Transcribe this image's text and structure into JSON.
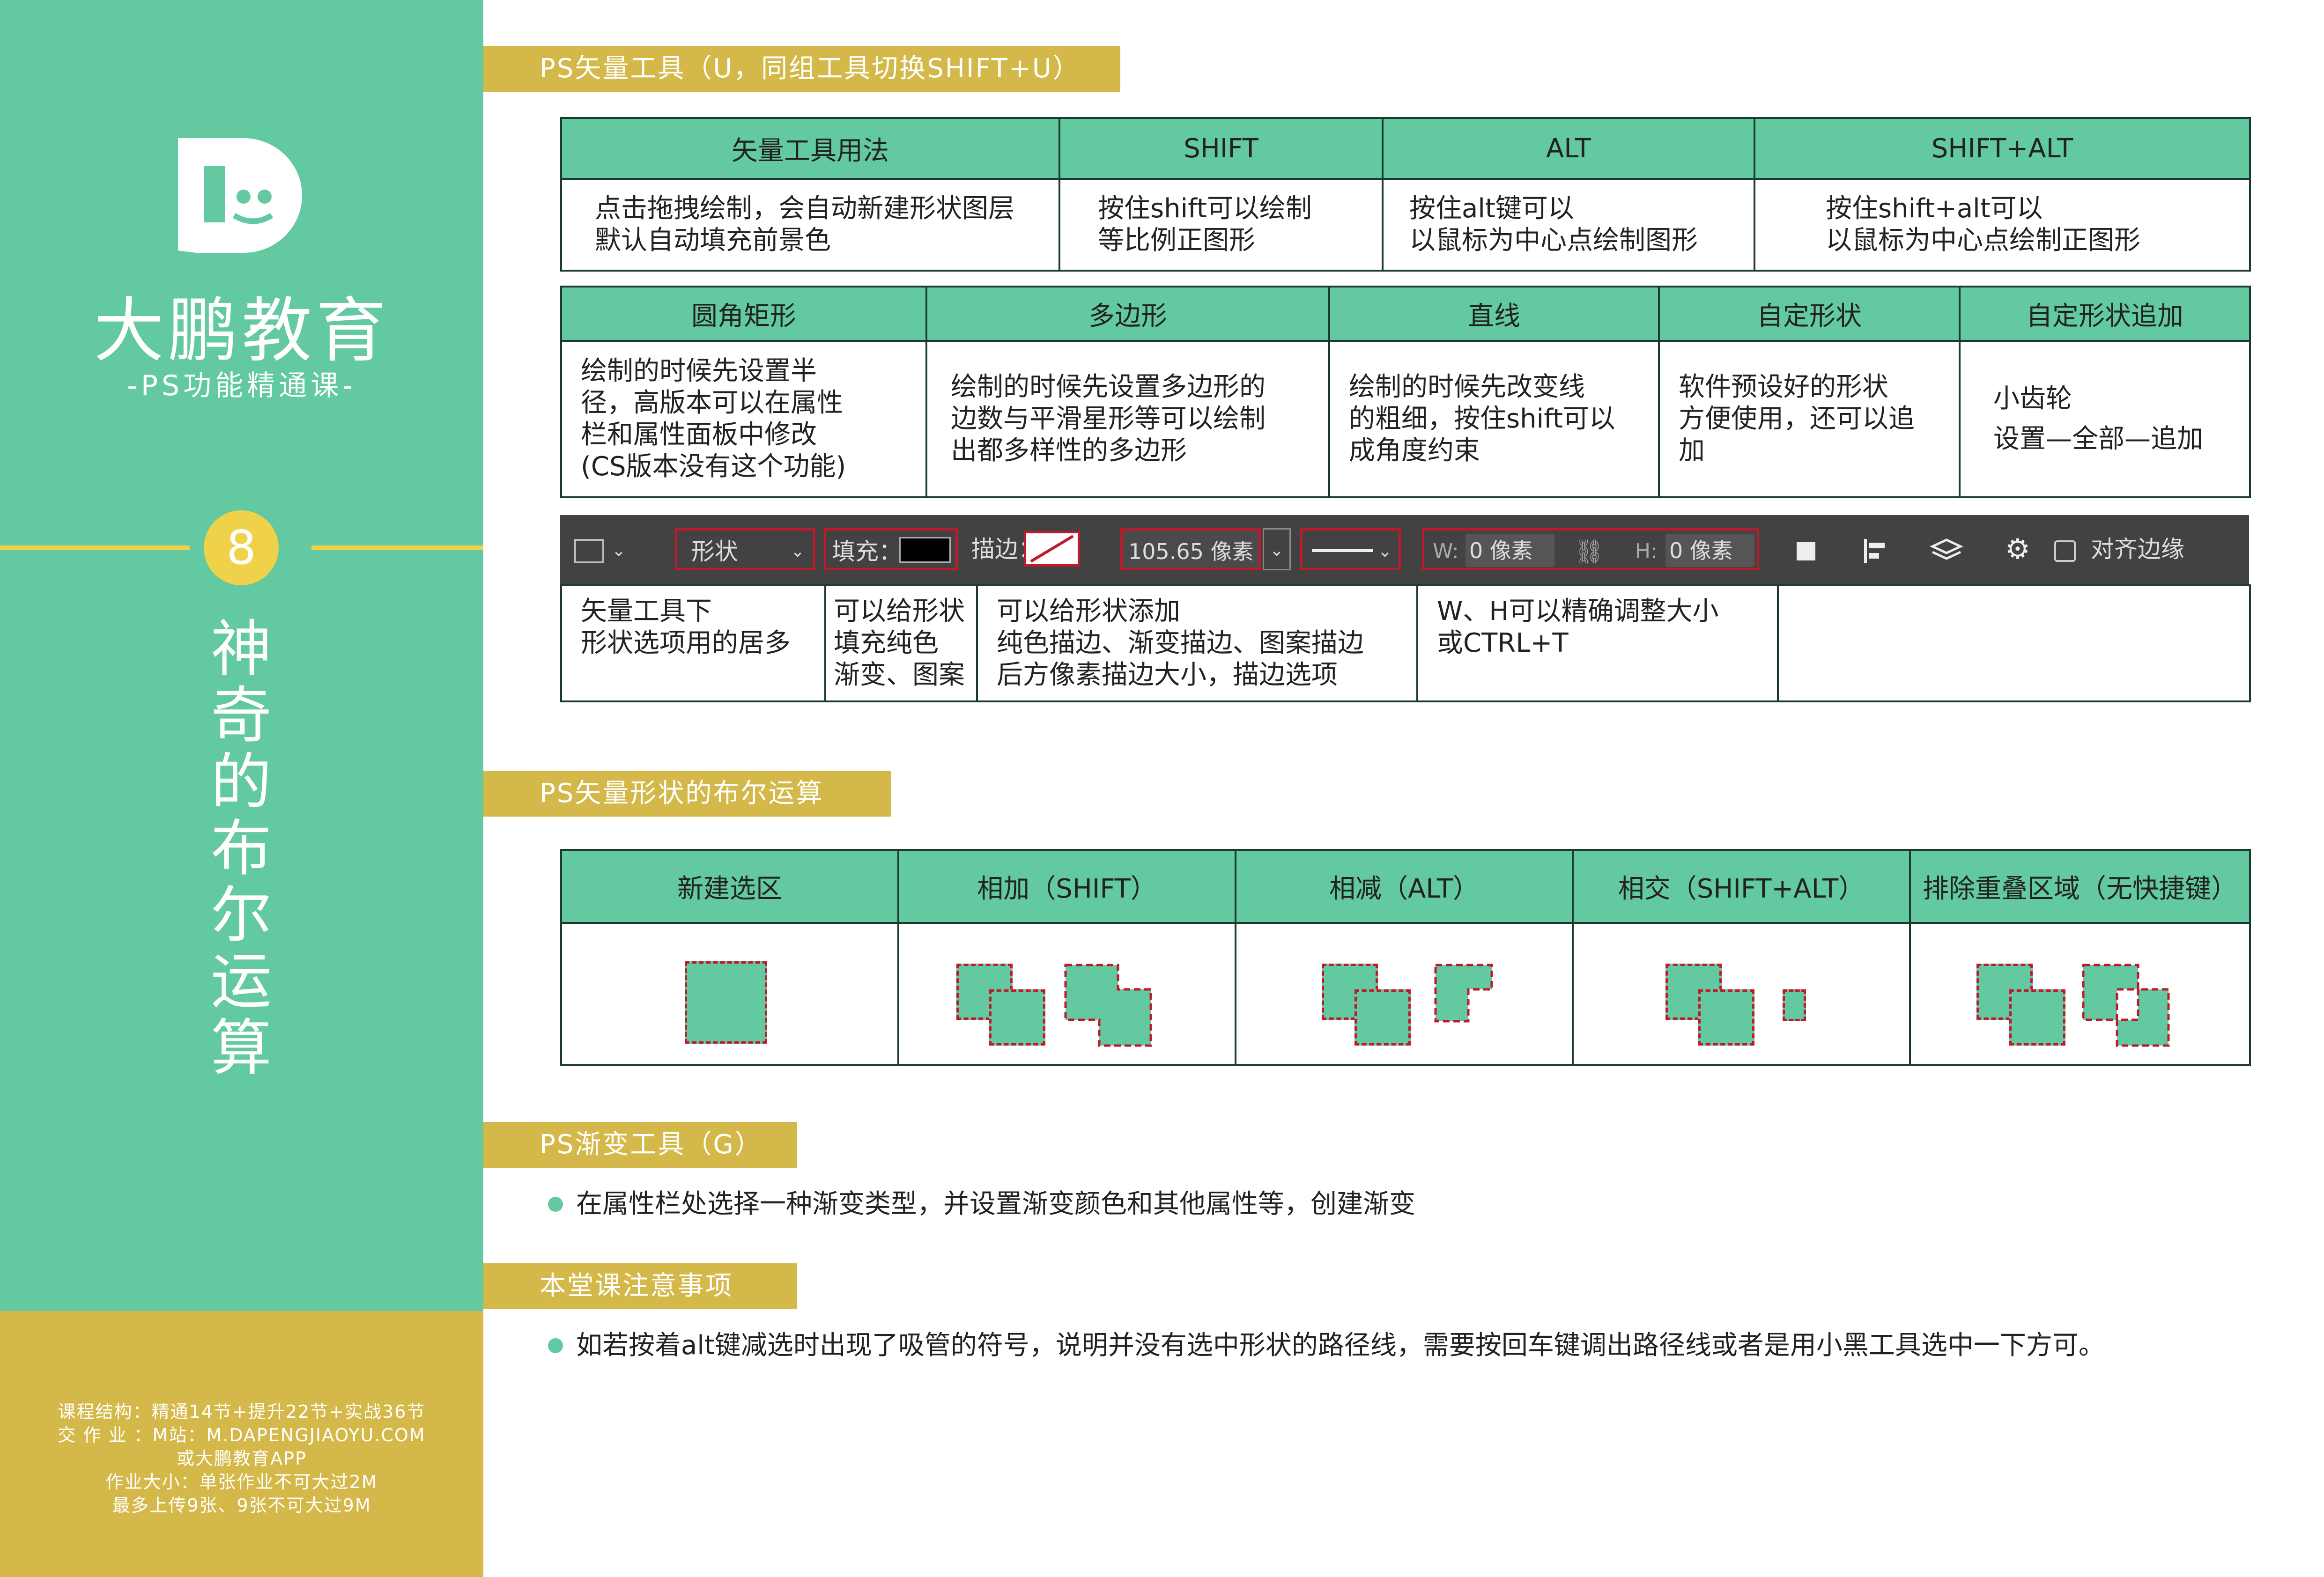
{
  "sidebar": {
    "brand": "大鹏教育",
    "subtitle": "-PS功能精通课-",
    "lesson_number": "8",
    "lesson_title": [
      "神",
      "奇",
      "的",
      "布",
      "尔",
      "运",
      "算"
    ],
    "footer_lines": [
      "课程结构：精通14节+提升22节+实战36节",
      "交 作 业 ：M站：M.DAPENGJIAOYU.COM",
      "或大鹏教育APP",
      "作业大小：单张作业不可大过2M",
      "最多上传9张、9张不可大过9M"
    ]
  },
  "colors": {
    "teal": "#62c9a0",
    "gold": "#d4b94a",
    "yellow": "#f0d24a",
    "red_dash": "#c0192c",
    "toolbar": "#424242"
  },
  "sections": {
    "vector": "PS矢量工具（U，同组工具切换SHIFT+U）",
    "boolean": "PS矢量形状的布尔运算",
    "gradient": "PS渐变工具（G）",
    "notes": "本堂课注意事项"
  },
  "table1": {
    "headers": [
      "矢量工具用法",
      "SHIFT",
      "ALT",
      "SHIFT+ALT"
    ],
    "cells": [
      "点击拖拽绘制，会自动新建形状图层\n默认自动填充前景色",
      "按住shift可以绘制\n等比例正图形",
      "按住alt键可以\n以鼠标为中心点绘制图形",
      "按住shift+alt可以\n以鼠标为中心点绘制正图形"
    ]
  },
  "table2": {
    "headers": [
      "圆角矩形",
      "多边形",
      "直线",
      "自定形状",
      "自定形状追加"
    ],
    "cells": [
      "绘制的时候先设置半\n径，高版本可以在属性\n栏和属性面板中修改\n(CS版本没有这个功能)",
      "绘制的时候先设置多边形的\n边数与平滑星形等可以绘制\n出都多样性的多边形",
      "绘制的时候先改变线\n的粗细，按住shift可以\n成角度约束",
      "软件预设好的形状\n方便使用，还可以追加",
      "小齿轮\n设置—全部—追加"
    ]
  },
  "toolbar": {
    "mode": "形状",
    "fill_label": "填充：",
    "stroke_label": "描边：",
    "stroke_width": "105.65 像素",
    "w_label": "W:",
    "w_value": "0 像素",
    "h_label": "H:",
    "h_value": "0 像素",
    "align_edges": "对齐边缘"
  },
  "table3": {
    "cells": [
      "矢量工具下\n形状选项用的居多",
      "可以给形状\n填充纯色\n渐变、图案",
      "可以给形状添加\n纯色描边、渐变描边、图案描边\n后方像素描边大小，描边选项",
      "W、H可以精确调整大小\n或CTRL+T",
      ""
    ]
  },
  "boolean_table": {
    "headers": [
      "新建选区",
      "相加（SHIFT）",
      "相减（ALT）",
      "相交（SHIFT+ALT）",
      "排除重叠区域（无快捷键）"
    ]
  },
  "gradient_text": "在属性栏处选择一种渐变类型，并设置渐变颜色和其他属性等，创建渐变",
  "notes_text": "如若按着alt键减选时出现了吸管的符号，说明并没有选中形状的路径线，需要按回车键调出路径线或者是用小黑工具选中一下方可。"
}
